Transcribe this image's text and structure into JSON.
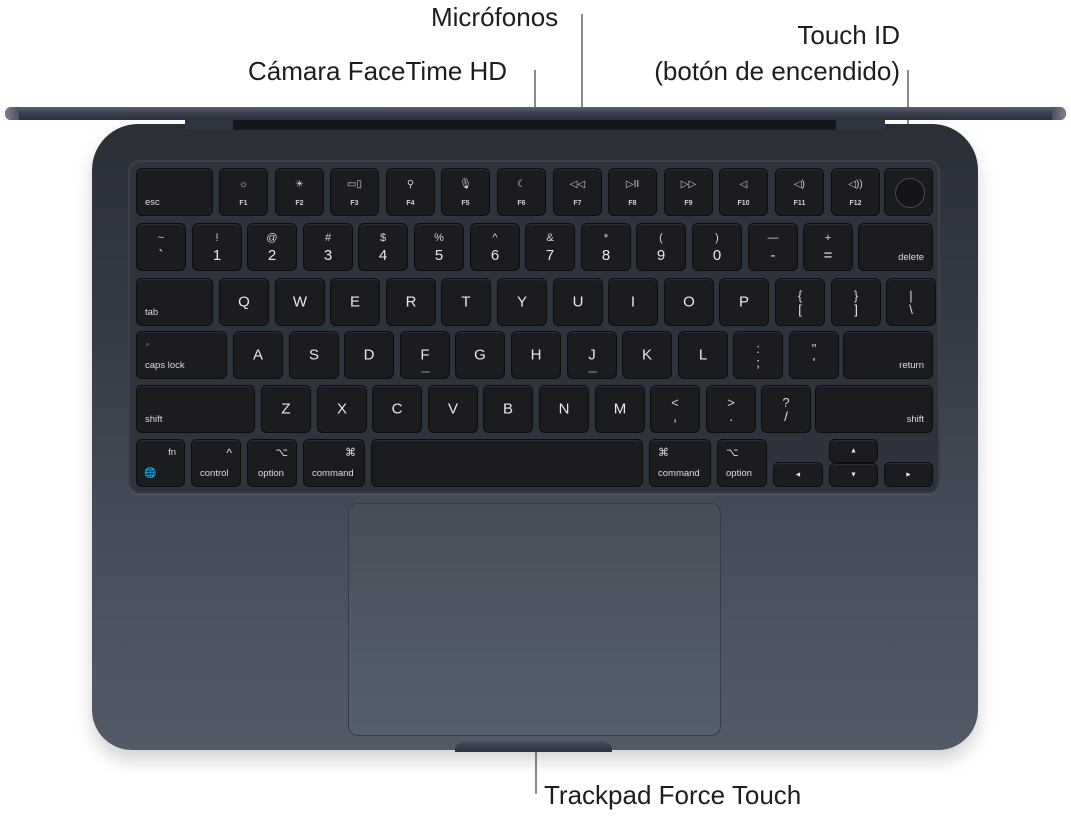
{
  "callouts": {
    "camera": "Cámara FaceTime HD",
    "microphones": "Micrófonos",
    "touchid_line1": "Touch ID",
    "touchid_line2": "(botón de encendido)",
    "trackpad": "Trackpad Force Touch"
  },
  "keyboard": {
    "frow": {
      "esc": "esc",
      "keys": [
        {
          "icon": "☼",
          "label": "F1",
          "icon_name": "brightness-down-icon"
        },
        {
          "icon": "☀",
          "label": "F2",
          "icon_name": "brightness-up-icon"
        },
        {
          "icon": "▭▯",
          "label": "F3",
          "icon_name": "mission-control-icon"
        },
        {
          "icon": "⚲",
          "label": "F4",
          "icon_name": "spotlight-search-icon"
        },
        {
          "icon": "🎙",
          "label": "F5",
          "icon_name": "dictation-microphone-icon"
        },
        {
          "icon": "☾",
          "label": "F6",
          "icon_name": "do-not-disturb-moon-icon"
        },
        {
          "icon": "◁◁",
          "label": "F7",
          "icon_name": "rewind-icon"
        },
        {
          "icon": "▷II",
          "label": "F8",
          "icon_name": "play-pause-icon"
        },
        {
          "icon": "▷▷",
          "label": "F9",
          "icon_name": "fast-forward-icon"
        },
        {
          "icon": "◁",
          "label": "F10",
          "icon_name": "mute-icon"
        },
        {
          "icon": "◁)",
          "label": "F11",
          "icon_name": "volume-down-icon"
        },
        {
          "icon": "◁))",
          "label": "F12",
          "icon_name": "volume-up-icon"
        }
      ]
    },
    "numrow": [
      {
        "top": "~",
        "bot": "`"
      },
      {
        "top": "!",
        "bot": "1"
      },
      {
        "top": "@",
        "bot": "2"
      },
      {
        "top": "#",
        "bot": "3"
      },
      {
        "top": "$",
        "bot": "4"
      },
      {
        "top": "%",
        "bot": "5"
      },
      {
        "top": "^",
        "bot": "6"
      },
      {
        "top": "&",
        "bot": "7"
      },
      {
        "top": "*",
        "bot": "8"
      },
      {
        "top": "(",
        "bot": "9"
      },
      {
        "top": ")",
        "bot": "0"
      },
      {
        "top": "—",
        "bot": "-"
      },
      {
        "top": "+",
        "bot": "="
      }
    ],
    "delete": "delete",
    "tab": "tab",
    "qrow": [
      "Q",
      "W",
      "E",
      "R",
      "T",
      "Y",
      "U",
      "I",
      "O",
      "P"
    ],
    "qrow_sym": [
      {
        "top": "{",
        "bot": "["
      },
      {
        "top": "}",
        "bot": "]"
      },
      {
        "top": "|",
        "bot": "\\"
      }
    ],
    "capslock": "caps lock",
    "arow": [
      "A",
      "S",
      "D",
      "F",
      "G",
      "H",
      "J",
      "K",
      "L"
    ],
    "arow_sym": [
      {
        "top": ":",
        "bot": ";"
      },
      {
        "top": "\"",
        "bot": "'"
      }
    ],
    "return": "return",
    "shift_left": "shift",
    "zrow": [
      "Z",
      "X",
      "C",
      "V",
      "B",
      "N",
      "M"
    ],
    "zrow_sym": [
      {
        "top": "<",
        "bot": ","
      },
      {
        "top": ">",
        "bot": "."
      },
      {
        "top": "?",
        "bot": "/"
      }
    ],
    "shift_right": "shift",
    "bottom": {
      "fn": "fn",
      "globe": "🌐",
      "control_sym": "^",
      "control": "control",
      "option_sym": "⌥",
      "option": "option",
      "command_sym": "⌘",
      "command": "command",
      "command_r_sym": "⌘",
      "command_r": "command",
      "option_r_sym": "⌥",
      "option_r": "option",
      "arrow_left": "◄",
      "arrow_up": "▲",
      "arrow_down": "▼",
      "arrow_right": "►"
    }
  }
}
